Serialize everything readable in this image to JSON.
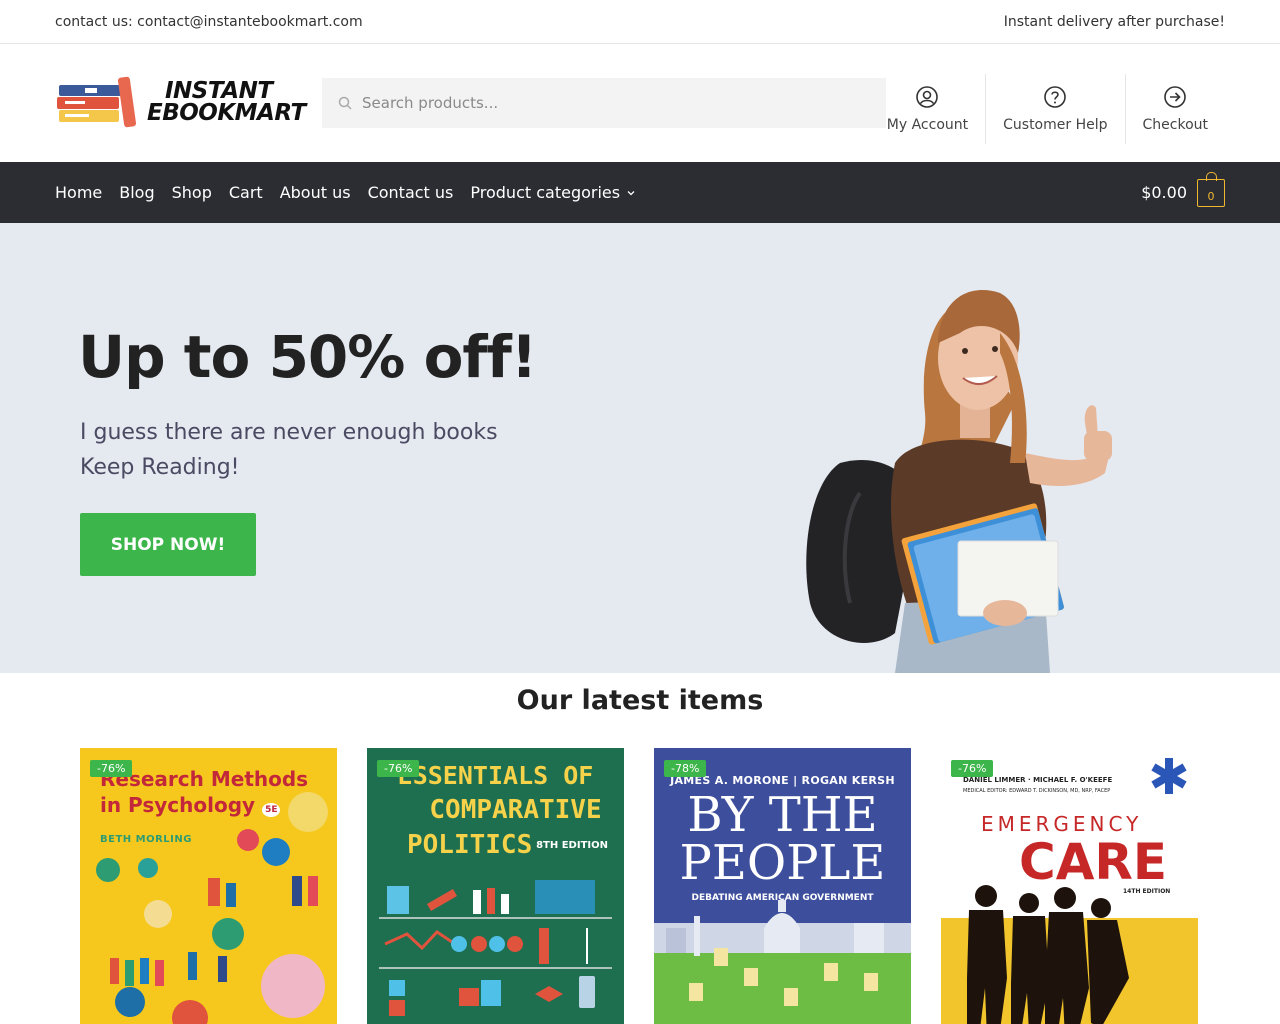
{
  "topbar": {
    "contact": "contact us: contact@instantebookmart.com",
    "delivery": "Instant delivery after purchase!"
  },
  "header": {
    "logo_line1": "INSTANT",
    "logo_line2": "EBOOKMART",
    "search_placeholder": "Search products...",
    "links": {
      "account": "My Account",
      "help": "Customer Help",
      "checkout": "Checkout"
    }
  },
  "nav": {
    "items": [
      "Home",
      "Blog",
      "Shop",
      "Cart",
      "About us",
      "Contact us",
      "Product categories"
    ],
    "cart_total": "$0.00",
    "cart_count": "0"
  },
  "hero": {
    "title": "Up to 50% off!",
    "line1": "I guess there are never enough books",
    "line2": "Keep Reading!",
    "button": "SHOP NOW!"
  },
  "latest": {
    "title": "Our latest items",
    "products": [
      {
        "badge": "-76%",
        "l1": "Research Methods",
        "l2": "in Psychology",
        "edition": "5E",
        "author": "BETH MORLING"
      },
      {
        "badge": "-76%",
        "l1": "ESSENTIALS OF",
        "l2": "COMPARATIVE",
        "l3": "POLITICS",
        "edition": "8TH EDITION"
      },
      {
        "badge": "-78%",
        "authors": "JAMES A. MORONE | ROGAN KERSH",
        "l1": "BY THE",
        "l2": "PEOPLE",
        "sub": "DEBATING AMERICAN GOVERNMENT"
      },
      {
        "badge": "-76%",
        "authors": "DANIEL LIMMER · MICHAEL F. O'KEEFE",
        "medical_editor": "MEDICAL EDITOR: EDWARD T. DICKINSON, MD, NRP, FACEP",
        "l1": "EMERGENCY",
        "l2": "CARE",
        "edition": "14TH EDITION"
      }
    ]
  },
  "colors": {
    "accent_green": "#3cb54a",
    "nav_bg": "#2c2d33",
    "hero_bg": "#e5e9f0",
    "cart_yellow": "#f0b72f"
  }
}
